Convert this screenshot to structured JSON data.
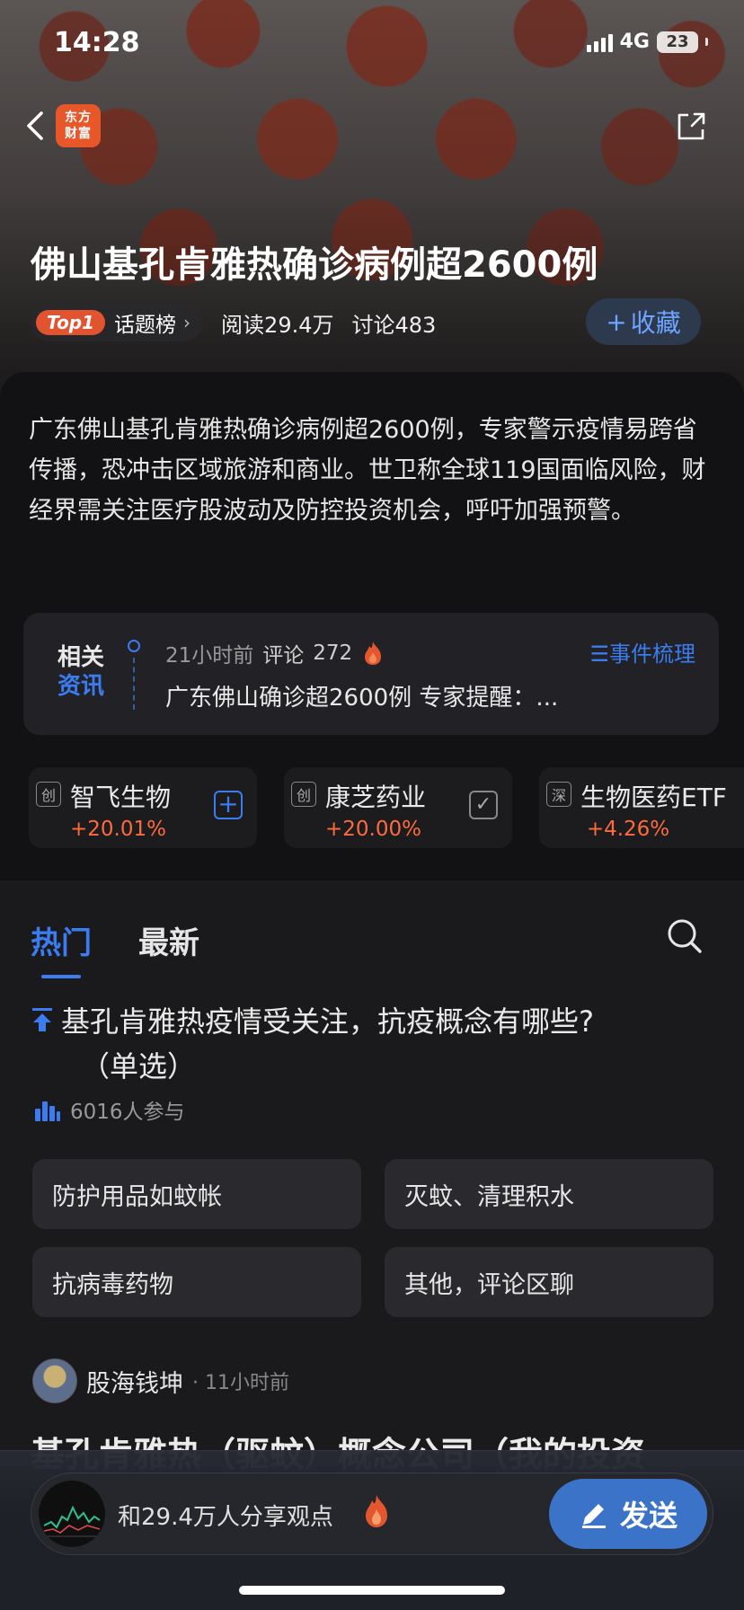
{
  "status_bar": {
    "time": "14:28",
    "network": "4G",
    "battery": "23"
  },
  "header": {
    "app_logo_line1": "东方",
    "app_logo_line2": "财富"
  },
  "topic": {
    "title": "佛山基孔肯雅热确诊病例超2600例",
    "rank_badge": "Top1",
    "rank_label": "话题榜",
    "reads": "阅读29.4万",
    "discussions": "讨论483",
    "collect_label": "收藏",
    "summary": "广东佛山基孔肯雅热确诊病例超2600例，专家警示疫情易跨省传播，恐冲击区域旅游和商业。世卫称全球119国面临风险，财经界需关注医疗股波动及防控投资机会，呼吁加强预警。"
  },
  "related_news": {
    "tag_line1": "相关",
    "tag_line2": "资讯",
    "time": "21小时前",
    "comment_label": "评论",
    "comment_count": "272",
    "events_link": "事件梳理",
    "headline": "广东佛山确诊超2600例 专家提醒：..."
  },
  "stocks": [
    {
      "market": "创",
      "name": "智飞生物",
      "change": "+20.01%",
      "action": "add"
    },
    {
      "market": "创",
      "name": "康芝药业",
      "change": "+20.00%",
      "action": "added"
    },
    {
      "market": "深",
      "name": "生物医药ETF",
      "change": "+4.26%",
      "action": "none"
    }
  ],
  "feed": {
    "tabs": [
      "热门",
      "最新"
    ],
    "active_tab": 0,
    "poll": {
      "question": "基孔肯雅热疫情受关注，抗疫概念有哪些?",
      "question_suffix": "（单选）",
      "participants": "6016人参与",
      "options": [
        "防护用品如蚊帐",
        "灭蚊、清理积水",
        "抗病毒药物",
        "其他，评论区聊"
      ]
    },
    "post": {
      "author": "股海钱坤",
      "time": "· 11小时前",
      "title": "基孔肯雅热（驱蚊）概念公司（我的投资"
    }
  },
  "compose": {
    "placeholder": "和29.4万人分享观点",
    "send_label": "发送"
  },
  "colors": {
    "accent": "#3b7cf0",
    "up": "#ff6a3d",
    "brand": "#e8572a"
  }
}
